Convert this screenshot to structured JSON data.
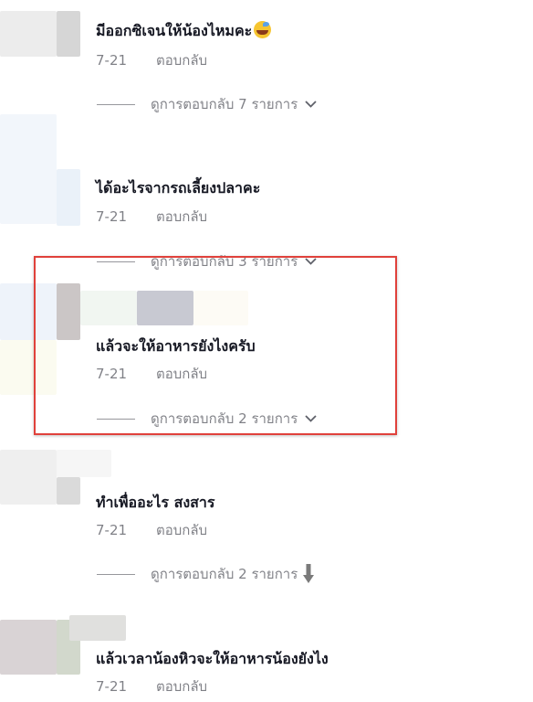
{
  "comments": [
    {
      "text": "มีออกซิเจนให้น้องไหมคะ",
      "has_emoji": true,
      "emoji_icon": "face-with-sweat-emoji",
      "date": "7-21",
      "reply_label": "ตอบกลับ",
      "view_replies": "ดูการตอบกลับ 7 รายการ"
    },
    {
      "text": "ได้อะไรจากรถเลี้ยงปลาคะ",
      "date": "7-21",
      "reply_label": "ตอบกลับ",
      "view_replies": "ดูการตอบกลับ 3 รายการ"
    },
    {
      "text": "แล้วจะให้อาหารยังไงครับ",
      "date": "7-21",
      "reply_label": "ตอบกลับ",
      "view_replies": "ดูการตอบกลับ 2 รายการ",
      "highlighted": true
    },
    {
      "text": "ทำเพื่ออะไร สงสาร",
      "date": "7-21",
      "reply_label": "ตอบกลับ",
      "view_replies": "ดูการตอบกลับ 2 รายการ"
    },
    {
      "text": "แล้วเวลาน้องหิวจะให้อาหารน้องยังไง",
      "date": "7-21",
      "reply_label": "ตอบกลับ"
    }
  ],
  "icons": {
    "expand": "chevron-down-icon",
    "cursor": "down-arrow-icon"
  },
  "colors": {
    "text": "#161823",
    "muted": "rgba(22,24,35,0.55)",
    "highlight_border": "#e0413b"
  }
}
